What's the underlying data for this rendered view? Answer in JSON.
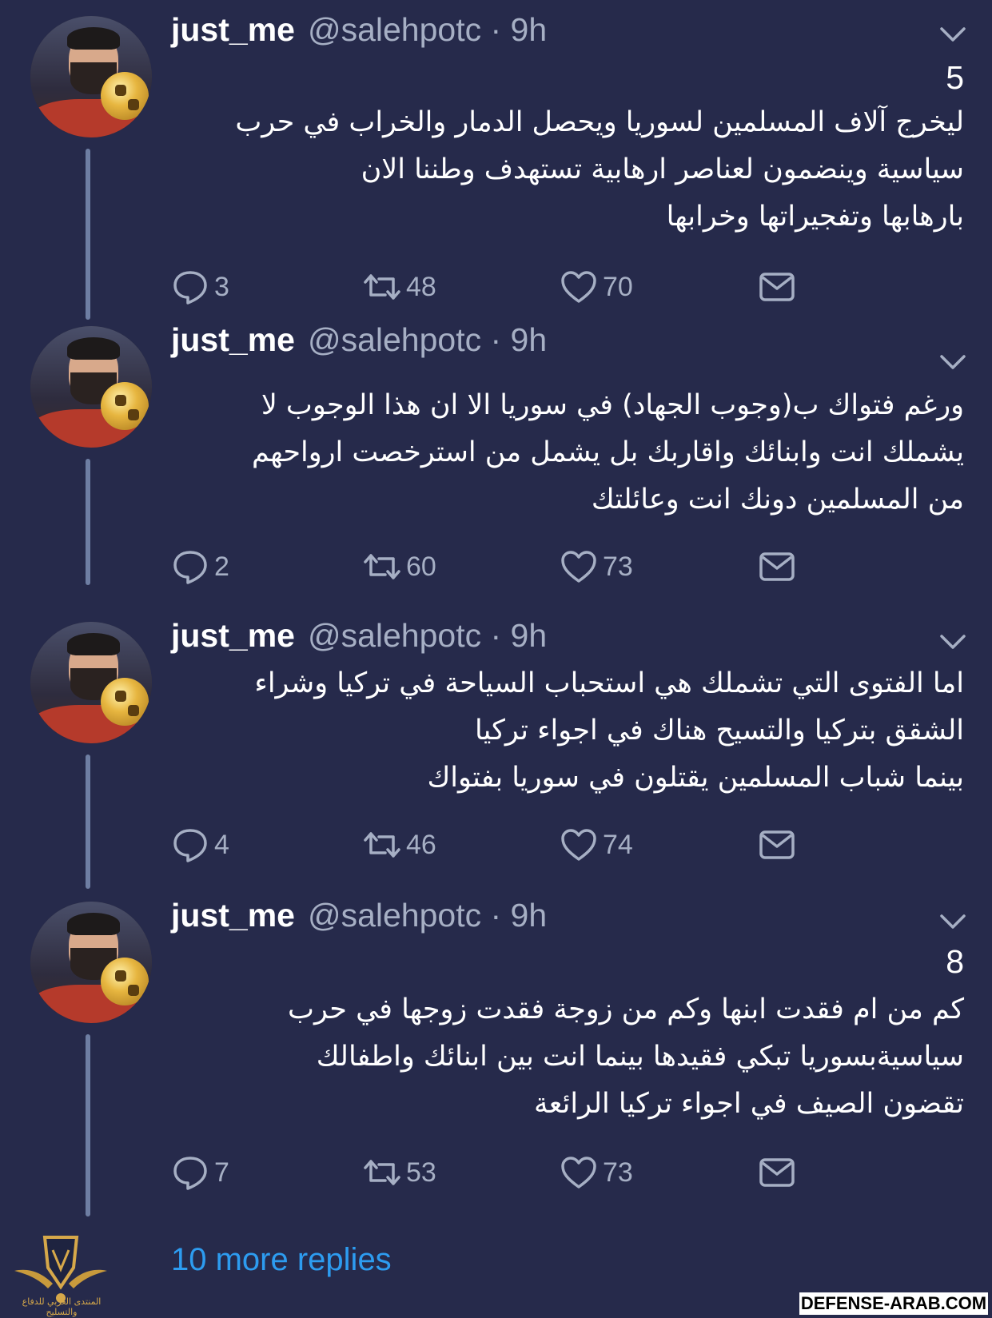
{
  "colors": {
    "background": "#262a4b",
    "text": "#ffffff",
    "secondary": "#a6afc4",
    "link": "#2d9cf0",
    "thread_line": "#6e7ea3"
  },
  "tweets": [
    {
      "name": "just_me",
      "handle_time": "@salehpotc · 9h",
      "number": "5",
      "lines": [
        "ليخرج آلاف المسلمين لسوريا ويحصل الدمار والخراب في حرب",
        "سياسية وينضمون لعناصر ارهابية تستهدف وطننا الان",
        "بارهابها وتفجيراتها وخرابها"
      ],
      "replies": "3",
      "retweets": "48",
      "likes": "70"
    },
    {
      "name": "just_me",
      "handle_time": "@salehpotc · 9h",
      "number": "",
      "lines": [
        "ورغم فتواك ب(وجوب الجهاد) في سوريا الا ان هذا الوجوب لا",
        "يشملك انت وابنائك واقاربك بل يشمل من استرخصت ارواحهم",
        "من المسلمين دونك انت وعائلتك"
      ],
      "replies": "2",
      "retweets": "60",
      "likes": "73"
    },
    {
      "name": "just_me",
      "handle_time": "@salehpotc · 9h",
      "number": "",
      "lines": [
        "اما الفتوى التي تشملك هي استحباب السياحة في تركيا وشراء",
        "الشقق بتركيا والتسيح هناك في اجواء تركيا",
        "بينما شباب المسلمين يقتلون في سوريا بفتواك"
      ],
      "replies": "4",
      "retweets": "46",
      "likes": "74"
    },
    {
      "name": "just_me",
      "handle_time": "@salehpotc · 9h",
      "number": "8",
      "lines": [
        "كم من ام فقدت ابنها وكم من زوجة فقدت زوجها في حرب",
        "سياسيةبسوريا تبكي فقيدها بينما انت بين ابنائك واطفالك",
        "تقضون الصيف في اجواء تركيا الرائعة"
      ],
      "replies": "7",
      "retweets": "53",
      "likes": "73"
    }
  ],
  "more_replies": "10 more replies",
  "watermark": "DEFENSE-ARAB.COM",
  "logo_text": "المنتدى العربي للدفاع والتسليح"
}
